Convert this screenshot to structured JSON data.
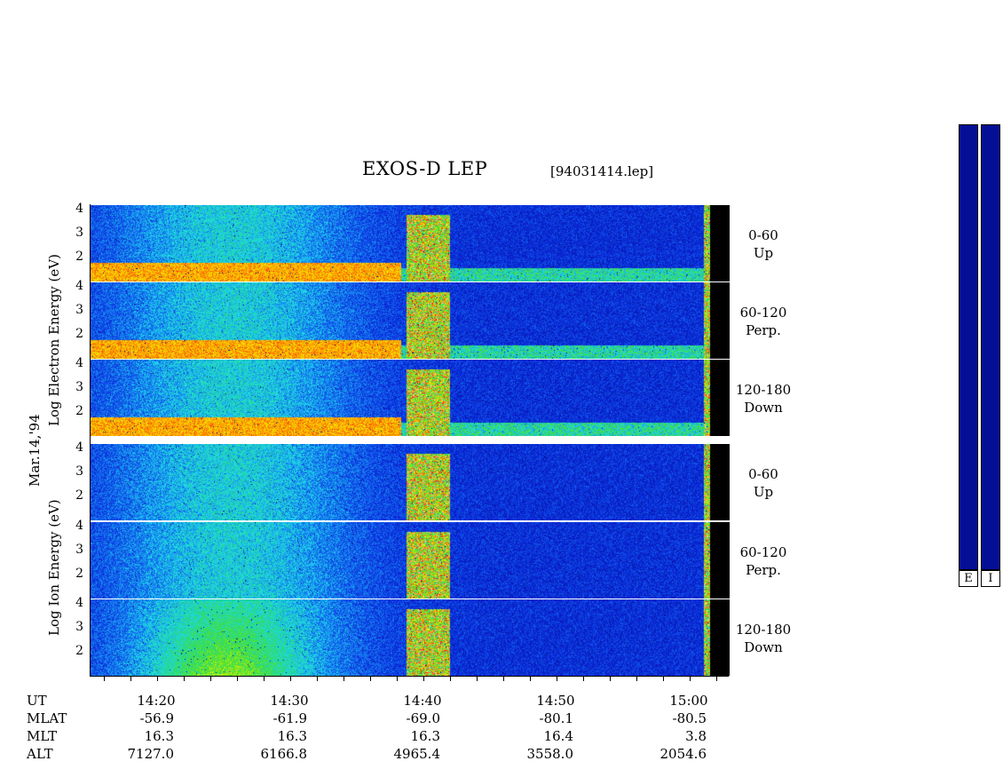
{
  "header": {
    "title": "EXOS-D LEP",
    "filename": "[94031414.lep]"
  },
  "side_labels": {
    "electron": "Log    Electron    Energy (eV)",
    "ion": "Log    Ion    Energy (eV)",
    "date": "Mar.14,'94"
  },
  "colorbar": {
    "electron_label": "E",
    "ion_label": "I"
  },
  "chart_data": {
    "type": "heatmap",
    "title": "EXOS-D LEP",
    "x_axis": {
      "label": "UT",
      "ticks": [
        "14:20",
        "14:30",
        "14:40",
        "14:50",
        "15:00"
      ]
    },
    "y_ticks": [
      "4",
      "3",
      "2"
    ],
    "y_range": [
      1,
      4.2
    ],
    "panels": [
      {
        "species": "Electron",
        "range": "0-60",
        "direction": "Up"
      },
      {
        "species": "Electron",
        "range": "60-120",
        "direction": "Perp."
      },
      {
        "species": "Electron",
        "range": "120-180",
        "direction": "Down"
      },
      {
        "species": "Ion",
        "range": "0-60",
        "direction": "Up"
      },
      {
        "species": "Ion",
        "range": "60-120",
        "direction": "Perp."
      },
      {
        "species": "Ion",
        "range": "120-180",
        "direction": "Down"
      }
    ],
    "ephemeris": {
      "rows": [
        {
          "name": "UT",
          "values": [
            "14:20",
            "14:30",
            "14:40",
            "14:50",
            "15:00"
          ]
        },
        {
          "name": "MLAT",
          "values": [
            "-56.9",
            "-61.9",
            "-69.0",
            "-80.1",
            "-80.5"
          ]
        },
        {
          "name": "MLT",
          "values": [
            "16.3",
            "16.3",
            "16.3",
            "16.4",
            "3.8"
          ]
        },
        {
          "name": "ALT",
          "values": [
            "7127.0",
            "6166.8",
            "4965.4",
            "3558.0",
            "2054.6"
          ]
        }
      ]
    }
  }
}
